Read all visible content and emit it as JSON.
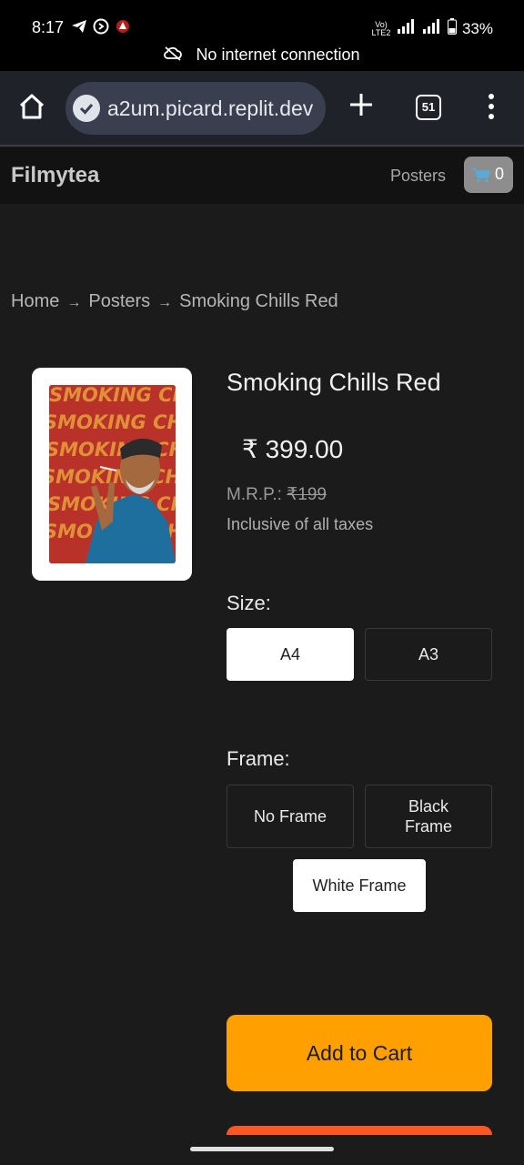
{
  "status_bar": {
    "time": "8:17",
    "battery": "33%",
    "network_label": "Vo)) LTE2",
    "connection_notice": "No internet connection"
  },
  "browser": {
    "url": "a2um.picard.replit.dev",
    "tab_count": "51",
    "icons": [
      "home-icon",
      "verified-check-icon",
      "plus-icon",
      "tabs-icon",
      "more-vert-icon"
    ]
  },
  "site": {
    "brand": "Filmytea",
    "nav_posters": "Posters",
    "cart_count": "0"
  },
  "breadcrumb": {
    "items": [
      "Home",
      "Posters",
      "Smoking Chills Red"
    ],
    "separator": "→"
  },
  "product": {
    "title": "Smoking Chills Red",
    "price": "₹ 399.00",
    "mrp_label": "M.R.P.:",
    "mrp_value": "₹199",
    "taxes_note": "Inclusive of all taxes",
    "poster_text": "SMOKING CHILLS"
  },
  "options": {
    "size_label": "Size:",
    "sizes": [
      "A4",
      "A3"
    ],
    "selected_size": "A4",
    "frame_label": "Frame:",
    "frames": [
      "No Frame",
      "Black Frame",
      "White Frame"
    ],
    "selected_frame": "White Frame"
  },
  "actions": {
    "add_to_cart": "Add to Cart"
  },
  "colors": {
    "accent": "#ffa000",
    "buy_now": "#ff5722",
    "background": "#1b1b1b"
  }
}
